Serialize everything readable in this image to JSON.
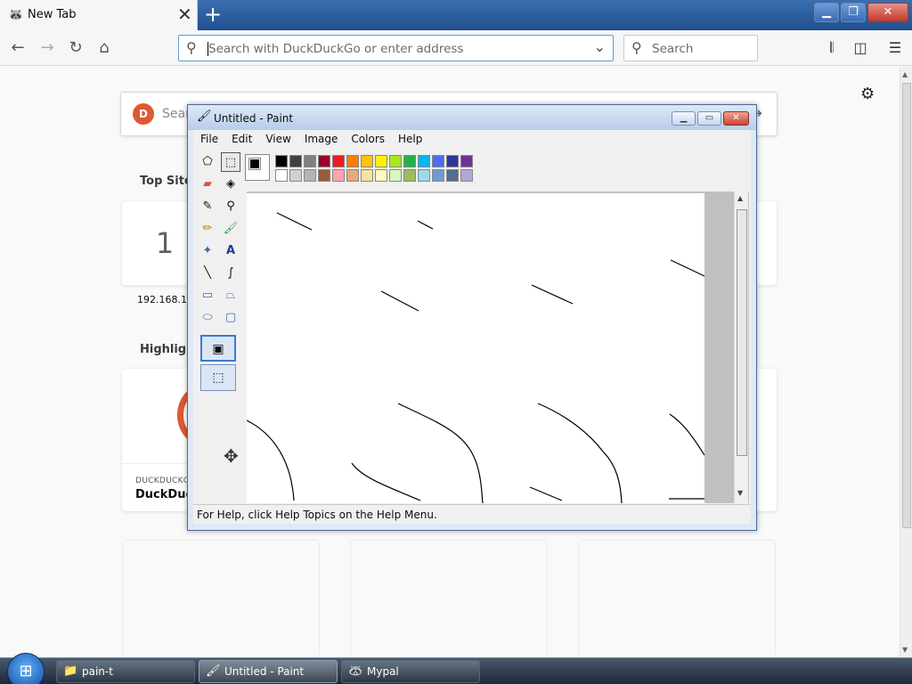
{
  "browser": {
    "tab_title": "New Tab",
    "tab_close": "✕",
    "new_tab": "+",
    "urlbar_placeholder": "Search with DuckDuckGo or enter address",
    "search_placeholder": "Search",
    "window_buttons": [
      "minimize",
      "restore",
      "close"
    ]
  },
  "newtab": {
    "search_placeholder": "Sear",
    "top_sites_title": "Top Sites",
    "top_site": {
      "letter": "1",
      "label": "192.168.1.1"
    },
    "highlights_title": "Highligh",
    "highlight": {
      "source": "DUCKDUCKG",
      "title": "DuckDuck"
    }
  },
  "paint": {
    "title": "Untitled - Paint",
    "menu": [
      "File",
      "Edit",
      "View",
      "Image",
      "Colors",
      "Help"
    ],
    "status_text": "For Help, click Help Topics on the Help Menu.",
    "palette_top": [
      "#000000",
      "#404040",
      "#808080",
      "#990030",
      "#ed1c24",
      "#ff7e00",
      "#ffc20e",
      "#fff200",
      "#a8e61d",
      "#22b14c",
      "#00b7ef",
      "#4d6df3",
      "#2f3699",
      "#6f3198"
    ],
    "palette_bottom": [
      "#ffffff",
      "#d0d0d0",
      "#b4b4b4",
      "#9c5a3c",
      "#ffa3b1",
      "#e5aa7a",
      "#f5e49c",
      "#fff9bd",
      "#d3f9bc",
      "#9dbb61",
      "#99d9ea",
      "#709ad1",
      "#546d8e",
      "#b5a5d5"
    ],
    "tools": [
      "free-select-icon",
      "rect-select-icon",
      "eraser-icon",
      "fill-icon",
      "color-picker-icon",
      "magnifier-icon",
      "pencil-icon",
      "brush-icon",
      "airbrush-icon",
      "text-icon",
      "line-icon",
      "curve-icon",
      "rectangle-icon",
      "polygon-icon",
      "ellipse-icon",
      "rounded-rect-icon"
    ]
  },
  "taskbar": {
    "items": [
      "pain-t",
      "Untitled - Paint",
      "Mypal"
    ]
  }
}
